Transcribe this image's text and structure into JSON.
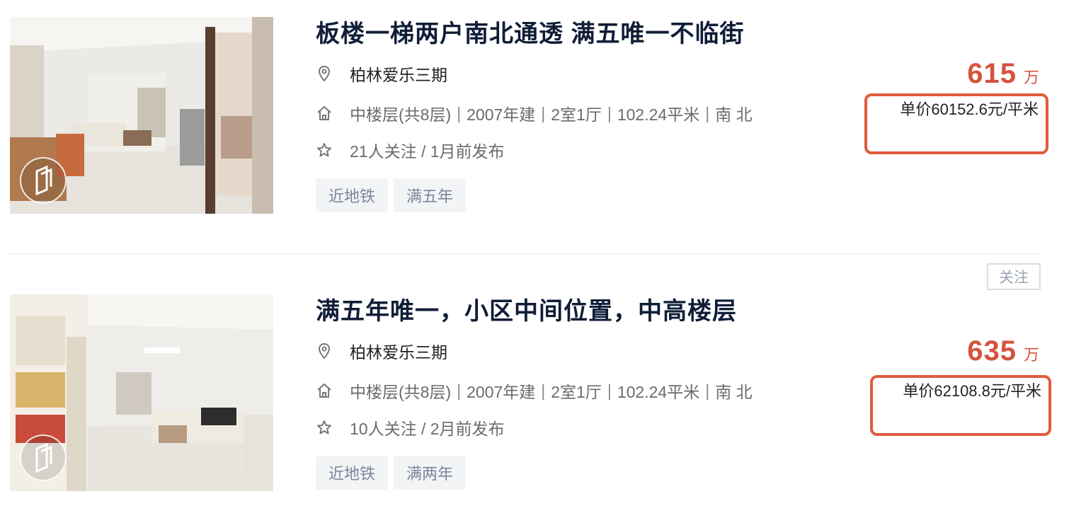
{
  "colors": {
    "price": "#d5533e",
    "highlight_border": "#e05b3e",
    "title": "#101d37",
    "tag_bg": "#f3f4f6"
  },
  "listings": [
    {
      "title": "板楼一梯两户南北通透 满五唯一不临街",
      "community": "柏林爱乐三期",
      "house_info": {
        "floor": "中楼层(共8层)",
        "built": "2007年建",
        "layout": "2室1厅",
        "area": "102.24平米",
        "orientation": "南 北"
      },
      "follow_info": "21人关注 / 1月前发布",
      "tags": [
        "近地铁",
        "满五年"
      ],
      "total_price": "615",
      "total_price_unit": "万",
      "unit_price": "单价60152.6元/平米",
      "icons": {
        "location": "location-pin-icon",
        "house": "house-icon",
        "star": "star-icon"
      }
    },
    {
      "title": "满五年唯一，小区中间位置，中高楼层",
      "community": "柏林爱乐三期",
      "house_info": {
        "floor": "中楼层(共8层)",
        "built": "2007年建",
        "layout": "2室1厅",
        "area": "102.24平米",
        "orientation": "南 北"
      },
      "follow_info": "10人关注 / 2月前发布",
      "tags": [
        "近地铁",
        "满两年"
      ],
      "total_price": "635",
      "total_price_unit": "万",
      "unit_price": "单价62108.8元/平米",
      "follow_button": "关注",
      "icons": {
        "location": "location-pin-icon",
        "house": "house-icon",
        "star": "star-icon"
      }
    }
  ]
}
